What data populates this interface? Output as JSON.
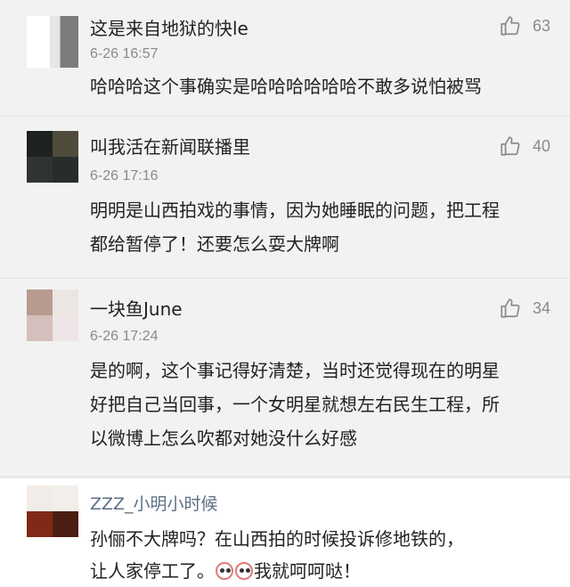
{
  "comments": [
    {
      "username": "这是来自地狱的快le",
      "time": "6-26 16:57",
      "likes": "63",
      "text": "哈哈哈这个事确实是哈哈哈哈哈哈不敢多说怕被骂"
    },
    {
      "username": "叫我活在新闻联播里",
      "time": "6-26 17:16",
      "likes": "40",
      "lines": [
        "明明是山西拍戏的事情，因为她睡眠的问题，把工程",
        "都给暂停了！还要怎么耍大牌啊"
      ]
    },
    {
      "username": "一块鱼June",
      "time": "6-26 17:24",
      "likes": "34",
      "lines": [
        "是的啊，这个事记得好清楚，当时还觉得现在的明星",
        "好把自己当回事，一个女明星就想左右民生工程，所",
        "以微博上怎么吹都对她没什么好感"
      ]
    },
    {
      "username": "ZZZ_小明小时候",
      "line1": "孙俪不大牌吗？在山西拍的时候投诉修地铁的，",
      "line2_a": "让人家停工了。",
      "line2_b": "我就呵呵哒！"
    }
  ],
  "icons": {
    "like": "thumbs-up-icon",
    "emoji": "laughing-emoji-icon"
  },
  "colors": {
    "bg": "#f2f2f2",
    "muted": "#8a8a8a",
    "username_blue": "#5d6f86"
  }
}
